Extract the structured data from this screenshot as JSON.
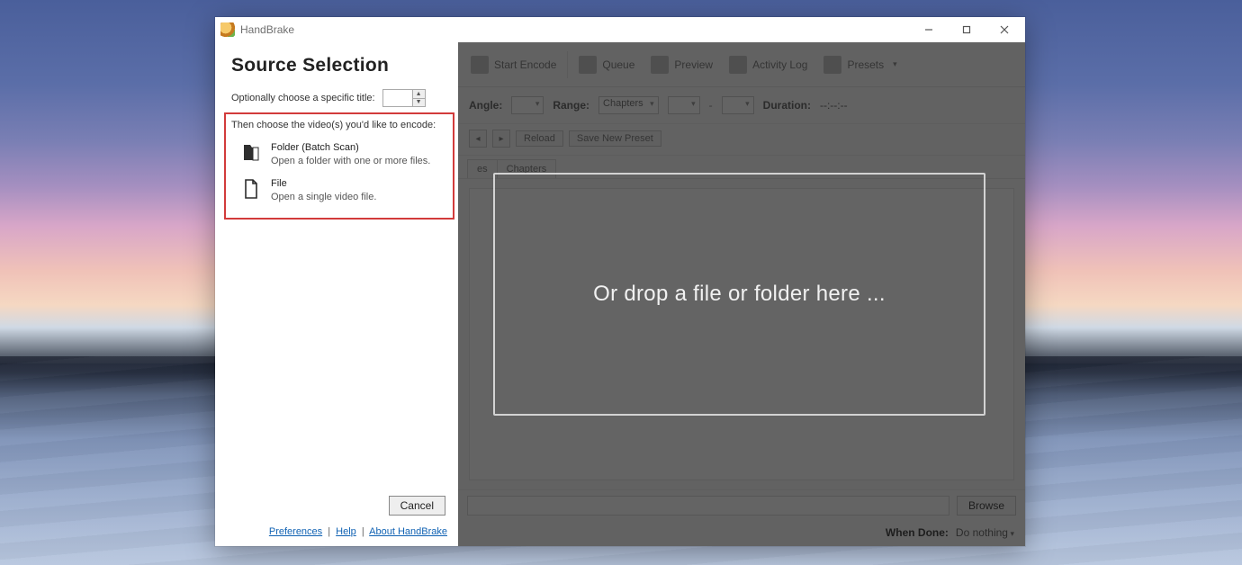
{
  "window": {
    "title": "HandBrake"
  },
  "sourcePanel": {
    "heading": "Source Selection",
    "optionalLabel": "Optionally choose a specific title:",
    "spinnerValue": "",
    "instruction": "Then choose the video(s) you'd like to encode:",
    "options": {
      "folder": {
        "title": "Folder (Batch Scan)",
        "subtitle": "Open a folder with one or more files."
      },
      "file": {
        "title": "File",
        "subtitle": "Open a single video file."
      }
    },
    "cancel": "Cancel",
    "links": {
      "preferences": "Preferences",
      "help": "Help",
      "about": "About HandBrake",
      "sep": "|"
    }
  },
  "toolbar": {
    "startEncode": "Start Encode",
    "queue": "Queue",
    "preview": "Preview",
    "activityLog": "Activity Log",
    "presets": "Presets"
  },
  "fields": {
    "angleLabel": "Angle:",
    "rangeLabel": "Range:",
    "rangeType": "Chapters",
    "durationLabel": "Duration:",
    "durationValue": "--:--:--",
    "reload": "Reload",
    "savePreset": "Save New Preset"
  },
  "tabs": {
    "middle": "es",
    "chapters": "Chapters"
  },
  "dropText": "Or drop a file or folder here ...",
  "saveRow": {
    "browse": "Browse"
  },
  "doneRow": {
    "label": "When Done:",
    "value": "Do nothing"
  }
}
